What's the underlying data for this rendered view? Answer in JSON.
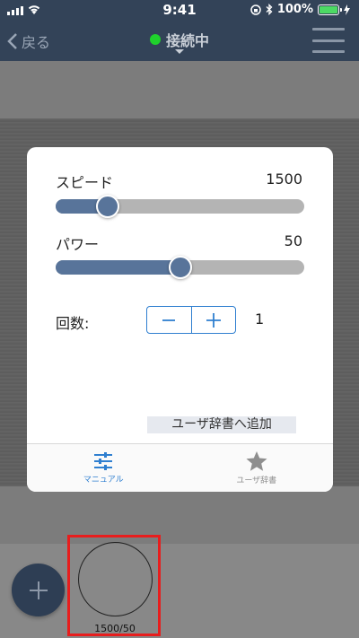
{
  "status_bar": {
    "time": "9:41",
    "battery_percent": "100%",
    "battery_level": 1.0
  },
  "nav": {
    "back_label": "戻る",
    "title": "接続中",
    "status_color": "#1fd12c"
  },
  "modal": {
    "speed": {
      "label": "スピード",
      "value": "1500",
      "fraction": 0.21
    },
    "power": {
      "label": "パワー",
      "value": "50",
      "fraction": 0.5
    },
    "count": {
      "label": "回数:",
      "value": "1"
    },
    "add_dict_label": "ユーザ辞書へ追加",
    "tabs": [
      {
        "label": "マニュアル",
        "icon": "sliders-icon",
        "active": true
      },
      {
        "label": "ユーザ辞書",
        "icon": "star-icon",
        "active": false
      }
    ]
  },
  "presets": [
    {
      "label": "1500/50"
    }
  ],
  "colors": {
    "navbar": "#334358",
    "accent": "#2f7fd0",
    "slider_fill": "#58749a",
    "highlight": "#e81d1d"
  }
}
